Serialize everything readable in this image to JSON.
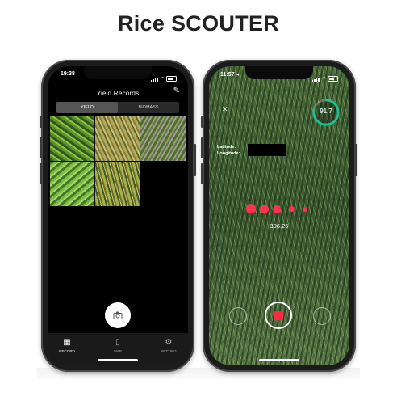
{
  "title": "Rice SCOUTER",
  "left_phone": {
    "status_time": "19:38",
    "header_title": "Yield Records",
    "edit_icon": "pencil-icon",
    "segments": [
      "YIELD",
      "BIOMASS"
    ],
    "active_segment": "YIELD",
    "tabs": [
      {
        "label": "RECORD",
        "icon": "grid-icon"
      },
      {
        "label": "MAP",
        "icon": "map-icon"
      },
      {
        "label": "SETTING",
        "icon": "gear-icon"
      }
    ],
    "camera_icon": "camera-icon"
  },
  "right_phone": {
    "status_time": "11:57",
    "gauge_value": "91.7",
    "gauge_percent": 78,
    "gauge_color": "#1fbf8f",
    "latitude_label": "Latitude:",
    "longitude_label": "Longitude:",
    "reading_value": "396.25",
    "dot_color": "#ff3150",
    "record_button_color": "#ff2846"
  }
}
